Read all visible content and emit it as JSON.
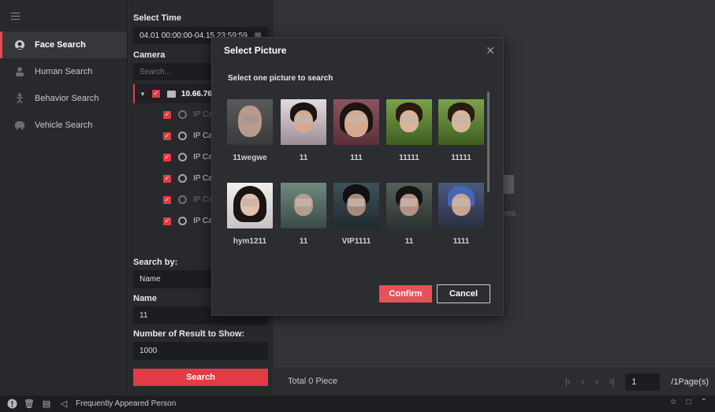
{
  "nav": {
    "items": [
      {
        "label": "Face Search",
        "icon": "face-search-icon",
        "active": true
      },
      {
        "label": "Human Search",
        "icon": "human-search-icon",
        "active": false
      },
      {
        "label": "Behavior Search",
        "icon": "behavior-search-icon",
        "active": false
      },
      {
        "label": "Vehicle Search",
        "icon": "vehicle-search-icon",
        "active": false
      }
    ]
  },
  "panel": {
    "select_time_label": "Select Time",
    "time_range": "04.01 00:00:00-04.15 23:59:59",
    "camera_label": "Camera",
    "camera_search_placeholder": "Search...",
    "tree_root": "10.66.76.",
    "cameras": [
      "IP Ca",
      "IP Ca",
      "IP Ca",
      "IP Ca",
      "IP Ca",
      "IP Ca"
    ],
    "search_by_label": "Search by:",
    "search_by_value": "Name",
    "name_label": "Name",
    "name_value": "11",
    "result_count_label": "Number of Result to Show:",
    "result_count_value": "1000",
    "search_button": "Search"
  },
  "main": {
    "empty_text": "res",
    "total": "Total 0 Piece",
    "page_input": "1",
    "page_total": "/1Page(s)"
  },
  "statusbar": {
    "label": "Frequently Appeared Person"
  },
  "modal": {
    "title": "Select Picture",
    "subtitle": "Select one picture to search",
    "pictures": [
      {
        "name": "11wegwe"
      },
      {
        "name": "11"
      },
      {
        "name": "111"
      },
      {
        "name": "11111"
      },
      {
        "name": "11111"
      },
      {
        "name": "hym1211"
      },
      {
        "name": "11"
      },
      {
        "name": "VIP1111"
      },
      {
        "name": "11"
      },
      {
        "name": "1111"
      }
    ],
    "confirm": "Confirm",
    "cancel": "Cancel"
  },
  "colors": {
    "accent": "#e23b45",
    "background": "#2b2d31",
    "panel": "#27292d"
  }
}
